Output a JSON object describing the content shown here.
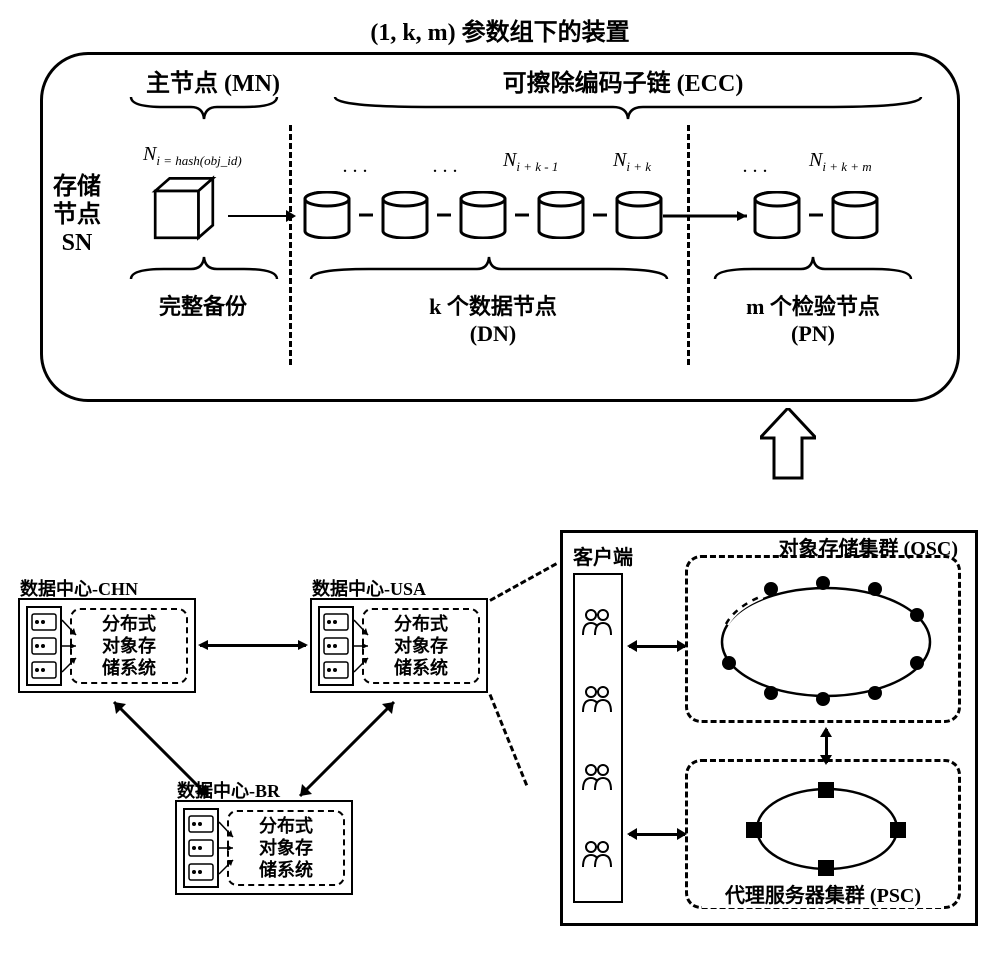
{
  "title": "(1, k, m) 参数组下的装置",
  "top": {
    "mn_label": "主节点 (MN)",
    "ecc_label": "可擦除编码子链 (ECC)",
    "sn_label_line1": "存储",
    "sn_label_line2": "节点",
    "sn_label_line3": "SN",
    "node_i": "N",
    "node_i_sub": "i = hash(obj_id)",
    "dots": ". . .",
    "node_ik1": "N",
    "node_ik1_sub": "i + k - 1",
    "node_ik": "N",
    "node_ik_sub": "i + k",
    "node_ikm": "N",
    "node_ikm_sub": "i + k + m",
    "full_backup": "完整备份",
    "dn_line1": "k 个数据节点",
    "dn_line2": "(DN)",
    "pn_line1": "m 个检验节点",
    "pn_line2": "(PN)"
  },
  "dc": {
    "chn": "数据中心-CHN",
    "usa": "数据中心-USA",
    "br": "数据中心-BR",
    "sys_l1": "分布式",
    "sys_l2": "对象存",
    "sys_l3": "储系统"
  },
  "right": {
    "client": "客户端",
    "osc": "对象存储集群 (OSC)",
    "psc": "代理服务器集群 (PSC)"
  }
}
